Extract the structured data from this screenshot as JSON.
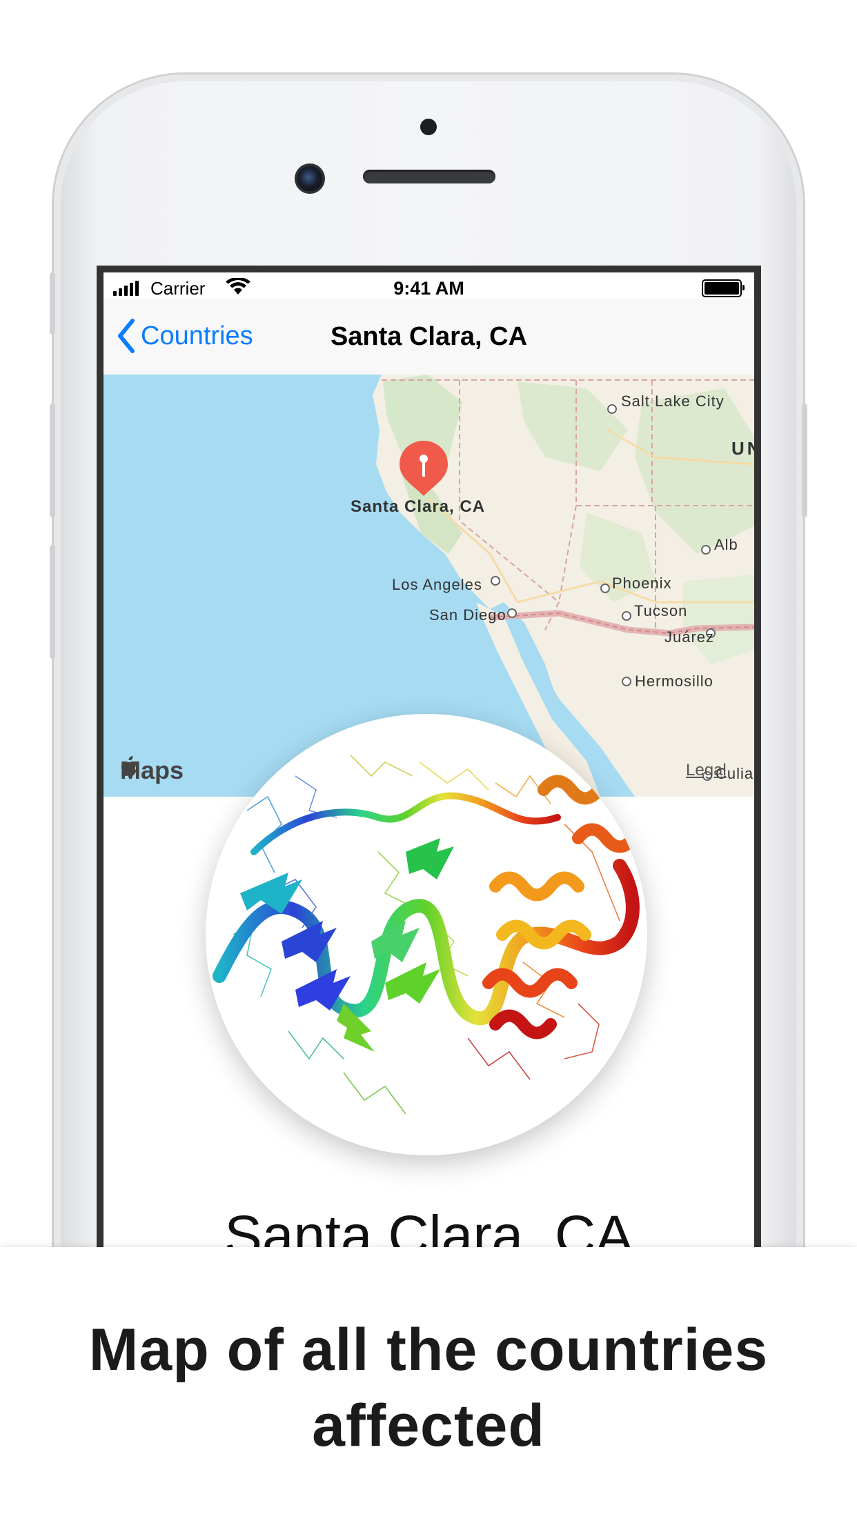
{
  "status_bar": {
    "carrier": "Carrier",
    "time": "9:41 AM"
  },
  "nav": {
    "back_label": "Countries",
    "title": "Santa Clara, CA"
  },
  "map": {
    "attribution": "Maps",
    "legal": "Legal",
    "pin_label": "Santa Clara, CA",
    "place_labels": {
      "salt_lake_city": "Salt Lake City",
      "un": "UN",
      "alb": "Alb",
      "los_angeles": "Los Angeles",
      "phoenix": "Phoenix",
      "san_diego": "San Diego",
      "tucson": "Tucson",
      "juarez": "Juárez",
      "hermosillo": "Hermosillo",
      "culia": "Culia"
    },
    "pin_color": "#f05a4a"
  },
  "detail": {
    "title": "Santa Clara, CA"
  },
  "caption": {
    "line1": "Map of all the countries",
    "line2": "affected"
  },
  "colors": {
    "accent": "#0a7cff",
    "water": "#a6dbf2",
    "land": "#f4f0e6"
  }
}
